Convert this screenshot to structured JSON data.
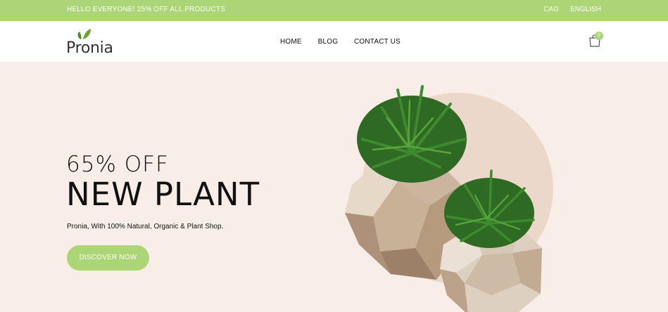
{
  "topbar": {
    "promo": "HELLO EVERYONE! 25% OFF ALL PRODUCTS",
    "currency": "CAD",
    "language": "ENGLISH"
  },
  "header": {
    "logo_text": "Pronia",
    "nav": [
      "HOME",
      "BLOG",
      "CONTACT US"
    ],
    "cart_count": "0"
  },
  "hero": {
    "offer": "65% OFF",
    "title": "NEW PLANT",
    "subtitle": "Pronia, With 100% Natural, Organic & Plant Shop.",
    "cta": "DISCOVER NOW"
  },
  "colors": {
    "accent": "#acd575",
    "hero_bg": "#f8ede7",
    "circle": "#ecd8cb"
  }
}
